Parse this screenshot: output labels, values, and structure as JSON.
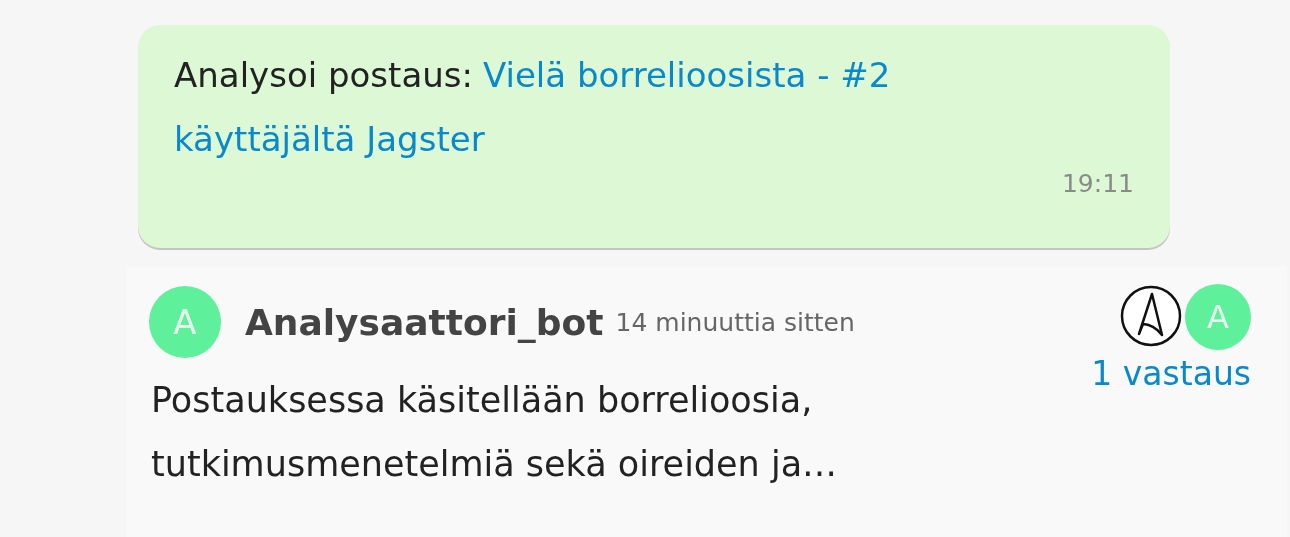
{
  "message": {
    "prefix": "Analysoi postaus:",
    "link_lines": [
      "Vielä borrelioosista - #2",
      "käyttäjältä Jagster"
    ],
    "time": "19:11"
  },
  "thread": {
    "avatar_letter": "A",
    "author": "Analysaattori_bot",
    "time_ago": "14 minuuttia sitten",
    "text": "Postauksessa käsitellään borrelioosia, tutkimusmenetelmiä sekä oireiden ja…",
    "participants": [
      {
        "kind": "logo"
      },
      {
        "kind": "letter",
        "letter": "A"
      }
    ],
    "replies": "1 vastaus"
  }
}
